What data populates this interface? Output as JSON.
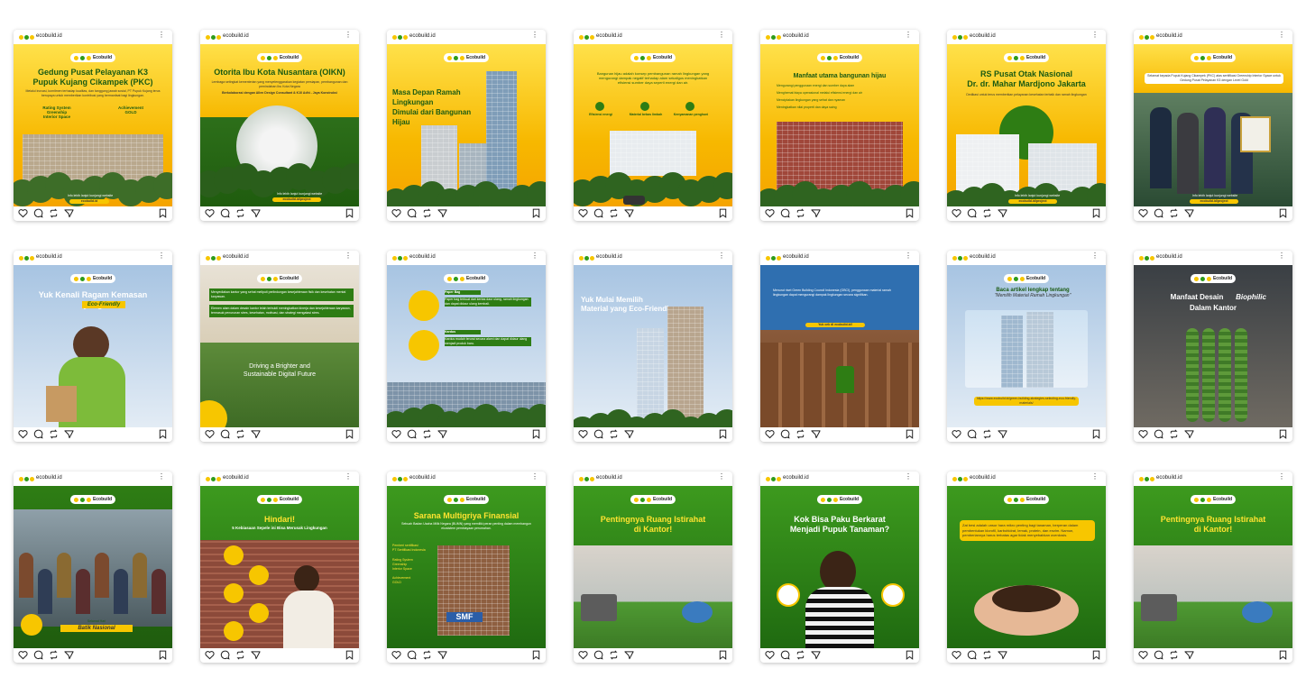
{
  "handle": "ecobuild.id",
  "logo_text": "Ecobuild",
  "posts": [
    {
      "title": "Gedung Pusat Pelayanan K3\nPupuk Kujang Cikampek (PKC)",
      "body": "Melalui inovasi, komitmen terhadap kualitas, dan tanggung jawab sosial, PT Pupuk Kujang terus berupaya untuk memberikan kontribusi yang bermanfaat bagi lingkungan.",
      "extra": "Rating System\nGreenship\nInterior Space",
      "extra2": "Achievement\nGOLD",
      "footer": "Info lebih lanjut kunjungi website",
      "cta": "ecobuild.id"
    },
    {
      "title": "Otorita Ibu Kota Nusantara (OIKN)",
      "body": "Lembaga setingkat kementerian yang menyelenggarakan kegiatan persiapan, pembangunan dan pemindahan Ibu Kota Negara",
      "extra": "Berkolaborasi dengan Allen Design Consultant & K10 Adhi - Jaya Konstruksi",
      "footer": "Info lebih lanjut kunjungi website",
      "cta": "ecobuild.id/project"
    },
    {
      "title": "Masa Depan Ramah Lingkungan\nDimulai dari Bangunan Hijau"
    },
    {
      "title": "Bangunan hijau adalah konsep pembangunan ramah lingkungan yang mengurangi dampak negatif terhadap alam sekaligus meningkatkan efisiensi sumber daya seperti energi dan air.",
      "labels": [
        "Efisiensi energi",
        "Material bebas limbah",
        "Kenyamanan penghuni"
      ]
    },
    {
      "title": "Manfaat utama bangunan hijau",
      "items": [
        "Mengurangi penggunaan energi dan sumber daya alam",
        "Menghemat biaya operasional melalui efisiensi energi dan air",
        "Menciptakan lingkungan yang sehat dan nyaman",
        "Meningkatkan nilai properti dan daya saing"
      ]
    },
    {
      "title": "RS Pusat Otak Nasional\nDr. dr. Mahar Mardjono Jakarta",
      "body": "Dedikasi untuk terus memberikan pelayanan kesehatan terbaik dan ramah lingkungan",
      "footer": "Info lebih lanjut kunjungi website",
      "cta": "ecobuild.id/project"
    },
    {
      "title": "Selamat kepada Pupuk Kujang Cikampek (PKC) atas sertifikasi Greenship Interior Space untuk Gedung Pusat Pelayanan K3 dengan Level Gold",
      "footer": "Info lebih lanjut kunjungi website",
      "cta": "ecobuild.id/project"
    },
    {
      "title": "Yuk Kenali Ragam Kemasan\nyang",
      "highlight": "Eco-Friendly"
    },
    {
      "body": "Menyediakan kantor yang sehat meliputi perlindungan kesejahteraan fisik dan kesehatan mental karyawan.",
      "body2": "Elemen alam dalam desain kantor telah terbukti meningkatkan kinerja dan kesejahteraan karyawan, termasuk penurunan stres, kesehatan, motivasi, dan strategi mengatasi stres.",
      "title": "Driving a Brighter and\nSustainable Digital Future"
    },
    {
      "labels": [
        "Paper Bag",
        "Kardus"
      ],
      "body": "Paper bag terbuat dari kertas daur ulang, ramah lingkungan dan dapat didaur ulang kembali.",
      "body2": "Kardus mudah terurai secara alami dan dapat didaur ulang menjadi produk baru."
    },
    {
      "title": "Yuk Mulai Memilih\nMaterial yang Eco-Friendly"
    },
    {
      "body": "Menurut riset Green Building Council Indonesia (GBCI), penggunaan material ramah lingkungan dapat mengurangi dampak lingkungan secara signifikan.",
      "cta": "Yuk cek di ecobuild.id!"
    },
    {
      "title": "Baca artikel lengkap tentang",
      "subtitle": "\"Memilih Material Ramah Lingkungan\"",
      "cta": "https://www.ecobuild.id/green-building-strategies-selecting-eco-friendly-materials/"
    },
    {
      "title": "Manfaat Desain",
      "italic": "Biophilic",
      "title2": "Dalam Kantor"
    },
    {
      "title": "Selamat Hari",
      "subtitle": "Batik Nasional"
    },
    {
      "title": "Hindari!",
      "subtitle": "5 Kebiasaan Sepele ini Bisa Merusak Lingkungan"
    },
    {
      "title": "Sarana Multigriya Finansial",
      "body": "Sebuah Badan Usaha Milik Negara (BUMN) yang memiliki peran penting dalam membangun ekosistem pembiayaan perumahan.",
      "extra": "Pemberi sertifikasi\nPT Sertifikasi Indonesia",
      "extra2": "Rating System\nGreenship\nInterior Space",
      "extra3": "Achievement\nGOLD",
      "sign": "SMF"
    },
    {
      "title": "Pentingnya Ruang Istirahat\ndi Kantor!"
    },
    {
      "title": "Kok Bisa Paku Berkarat\nMenjadi Pupuk Tanaman?"
    },
    {
      "body": "Zat besi adalah unsur hara mikro penting bagi tanaman, berperan dalam pembentukan klorofil, karbohidrat, lemak, protein, dan enzim. Namun, pemberiannya harus terbatas agar tidak menyebabkan overdosis."
    },
    {
      "title": "Pentingnya Ruang Istirahat\ndi Kantor!"
    }
  ],
  "colors": {
    "yellow": "#f7b800",
    "green": "#2e7d14",
    "dark_green": "#1f5c0e",
    "sky": "#8fb4d8"
  }
}
